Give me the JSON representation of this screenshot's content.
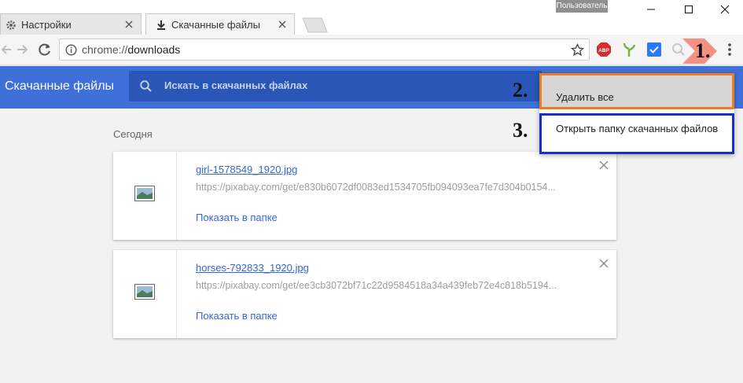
{
  "window": {
    "profile_badge": "Пользователь 1",
    "minimize": "minimize-icon",
    "maximize": "maximize-icon",
    "close": "close-icon"
  },
  "tabs": [
    {
      "label": "Настройки",
      "icon": "gear-icon"
    },
    {
      "label": "Скачанные файлы",
      "icon": "download-icon"
    }
  ],
  "toolbar": {
    "url_scheme": "chrome://",
    "url_host": "downloads",
    "extensions": [
      "adblock-icon",
      "plant-icon",
      "check-icon",
      "search-ext-icon"
    ],
    "colors": {
      "adblock": "#d32f2f",
      "check": "#2979ff",
      "plant": "#7cb342"
    }
  },
  "page": {
    "title": "Скачанные файлы",
    "search_placeholder": "Искать в скачанных файлах",
    "section_date": "Сегодня",
    "header_color": "#3f6fd8"
  },
  "downloads": [
    {
      "name": "girl-1578549_1920.jpg",
      "url": "https://pixabay.com/get/e830b6072df0083ed1534705fb094093ea7fe7d304b0154...",
      "action": "Показать в папке"
    },
    {
      "name": "horses-792833_1920.jpg",
      "url": "https://pixabay.com/get/ee3cb3072bf71c22d9584518a34a439feb72e4c818b5194...",
      "action": "Показать в папке"
    }
  ],
  "menu": {
    "items": [
      "Удалить все",
      "Открыть папку скачанных файлов"
    ]
  },
  "annotations": {
    "step1": "1.",
    "step2": "2.",
    "step3": "3.",
    "step1_arrow_color": "#f4877a",
    "step2_border": "#ee7d21",
    "step3_border": "#1a2ec8"
  }
}
